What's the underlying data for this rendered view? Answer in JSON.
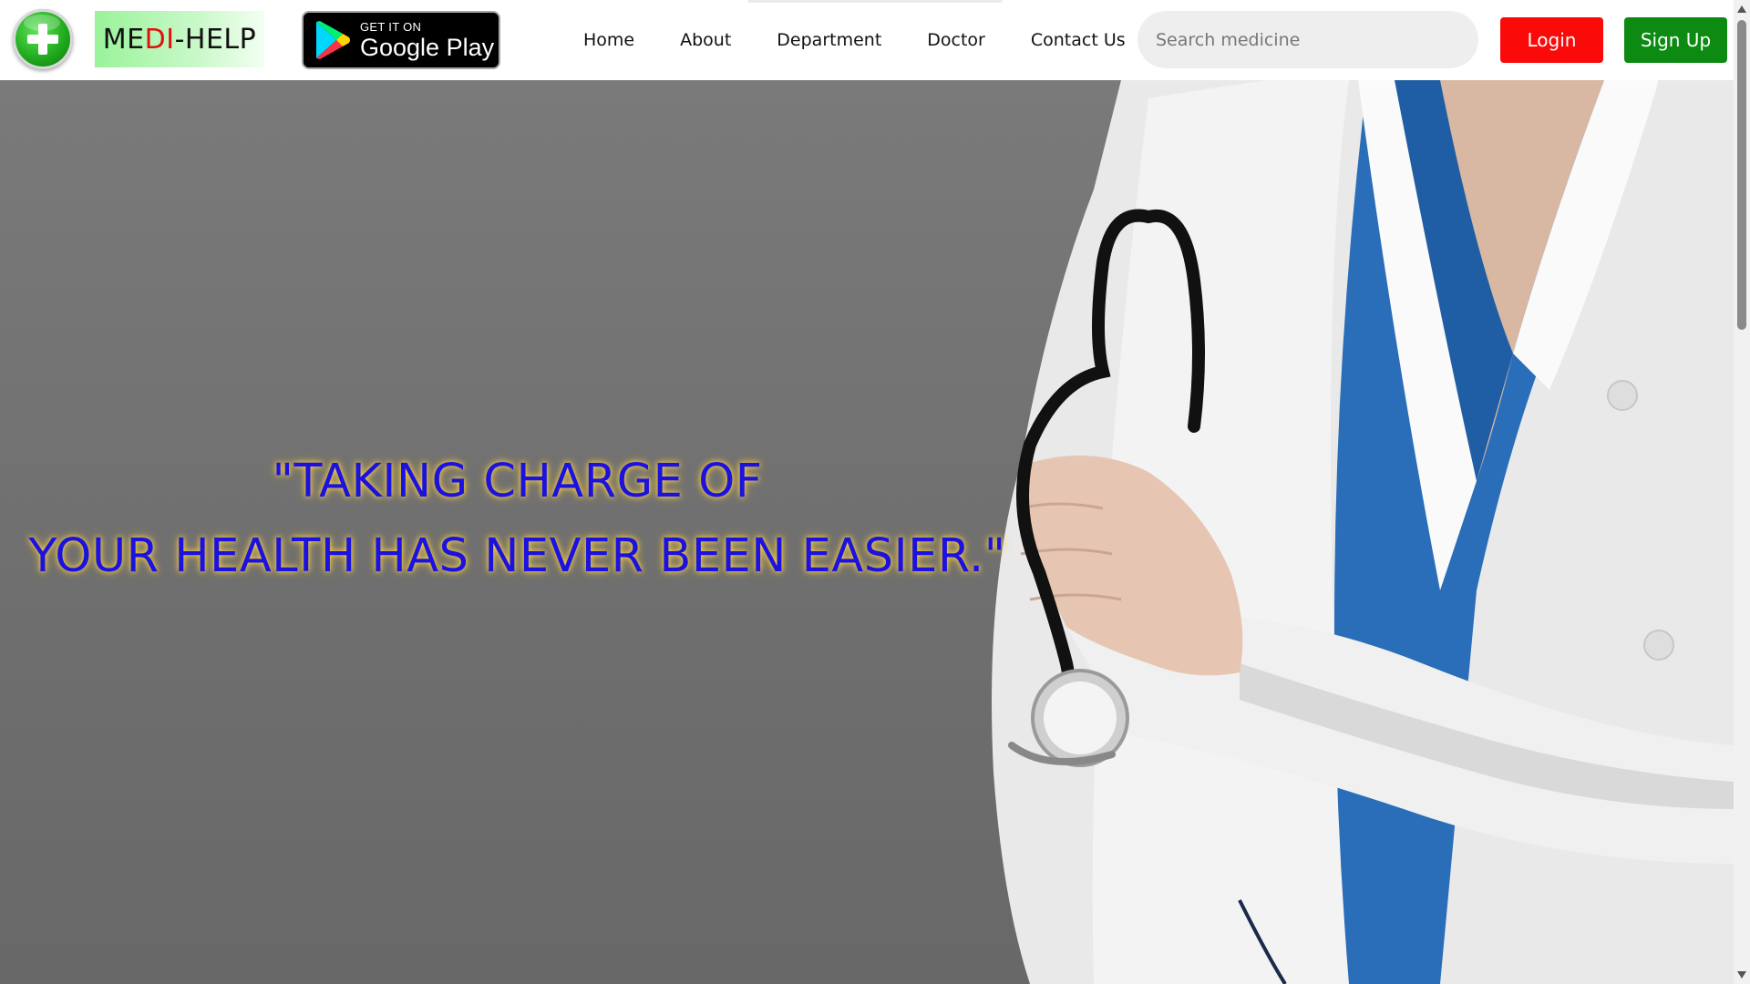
{
  "brand": {
    "name_part1": "ME",
    "name_part2": "DI",
    "name_part3": "-HELP",
    "logo_icon": "green-plus-circle-icon",
    "accent_red": "#e01010"
  },
  "google_play": {
    "small_text": "GET IT ON",
    "big_text": "Google Play",
    "icon": "google-play-icon"
  },
  "nav": {
    "items": [
      {
        "label": "Home"
      },
      {
        "label": "About"
      },
      {
        "label": "Department"
      },
      {
        "label": "Doctor"
      },
      {
        "label": "Contact Us"
      }
    ]
  },
  "search": {
    "placeholder": "Search medicine",
    "value": ""
  },
  "auth": {
    "login_label": "Login",
    "signup_label": "Sign Up",
    "login_color": "#fb0a0a",
    "signup_color": "#0c8a12"
  },
  "hero": {
    "quote_line1": "\"TAKING CHARGE OF",
    "quote_line2": "YOUR HEALTH HAS NEVER BEEN EASIER.\"",
    "quote_color": "#1c12e0",
    "glow_color": "#ffd84a",
    "background_color": "#727272"
  }
}
